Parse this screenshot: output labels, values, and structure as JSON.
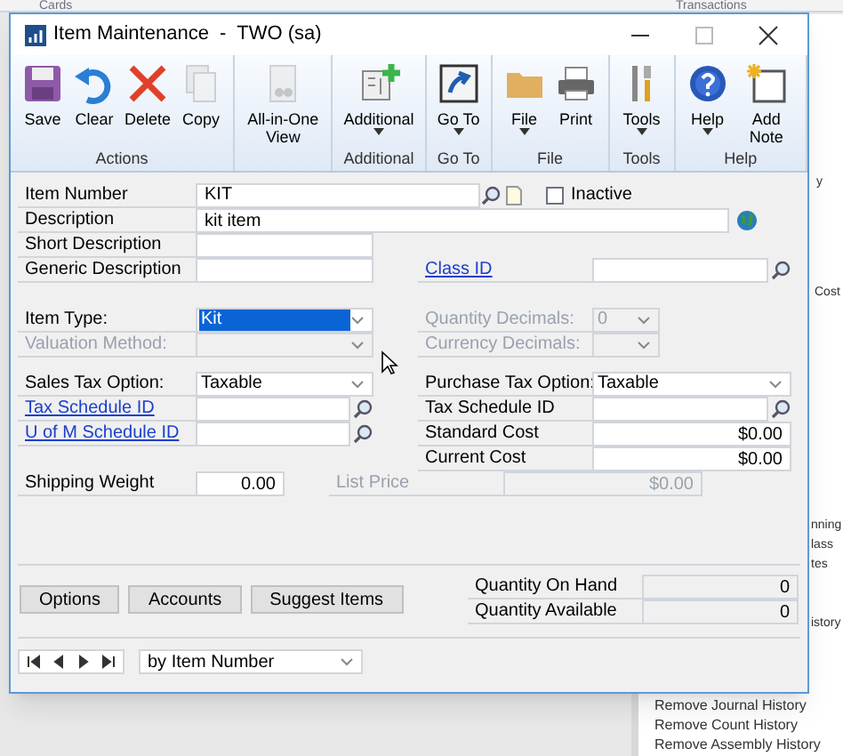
{
  "background": {
    "tabs": [
      "Cards",
      "Transactions"
    ],
    "fragments": [
      "y",
      "Cost",
      "nning",
      "lass",
      "tes",
      "istory"
    ],
    "list": [
      "Remove Journal History",
      "Remove Count History",
      "Remove Assembly History"
    ]
  },
  "window": {
    "title": "Item Maintenance  -  TWO (sa)"
  },
  "ribbon": [
    {
      "group": "Actions",
      "buttons": [
        {
          "label": "Save",
          "dropdown": false,
          "disabled": false
        },
        {
          "label": "Clear",
          "dropdown": false,
          "disabled": false
        },
        {
          "label": "Delete",
          "dropdown": false,
          "disabled": false
        },
        {
          "label": "Copy",
          "dropdown": false,
          "disabled": true
        }
      ]
    },
    {
      "buttons": [
        {
          "label": "All-in-One View",
          "dropdown": false,
          "disabled": true
        }
      ]
    },
    {
      "group": "Additional",
      "buttons": [
        {
          "label": "Additional",
          "dropdown": true,
          "disabled": false
        }
      ]
    },
    {
      "group": "Go To",
      "buttons": [
        {
          "label": "Go To",
          "dropdown": true,
          "disabled": false
        }
      ]
    },
    {
      "group": "File",
      "buttons": [
        {
          "label": "File",
          "dropdown": true,
          "disabled": false
        },
        {
          "label": "Print",
          "dropdown": false,
          "disabled": false
        }
      ]
    },
    {
      "group": "Tools",
      "buttons": [
        {
          "label": "Tools",
          "dropdown": true,
          "disabled": false
        }
      ]
    },
    {
      "group": "Help",
      "buttons": [
        {
          "label": "Help",
          "dropdown": true,
          "disabled": false
        },
        {
          "label": "Add Note",
          "dropdown": false,
          "disabled": false
        }
      ]
    }
  ],
  "item_number": {
    "label": "Item Number",
    "value": "KIT"
  },
  "inactive": {
    "label": "Inactive",
    "checked": false
  },
  "description": {
    "label": "Description",
    "value": "kit item"
  },
  "groups": [
    [
      {
        "left": {
          "label": "Short Description",
          "kind": "text",
          "link": false,
          "disabled": false
        }
      }
    ],
    [
      {
        "left": {
          "label": "Generic Description",
          "kind": "text",
          "link": false,
          "disabled": false
        },
        "right": {
          "label": "Class ID",
          "kind": "lookup",
          "link": true,
          "disabled": false
        }
      }
    ],
    [
      {
        "left": {
          "label": "Item Type:",
          "kind": "dropdown",
          "link": false,
          "disabled": false,
          "value": "Kit",
          "selected": true
        },
        "right": {
          "label": "Quantity Decimals:",
          "kind": "small_dropdown",
          "link": false,
          "disabled": true,
          "value": "0"
        }
      },
      {
        "left": {
          "label": "Valuation Method:",
          "kind": "dropdown",
          "link": false,
          "disabled": true
        },
        "right": {
          "label": "Currency Decimals:",
          "kind": "small_dropdown",
          "link": false,
          "disabled": true
        }
      }
    ],
    [
      {
        "left": {
          "label": "Sales Tax Option:",
          "kind": "dropdown",
          "link": false,
          "disabled": false,
          "value": "Taxable",
          "selected": false
        },
        "right": {
          "label": "Purchase Tax Option:",
          "kind": "dropdown",
          "link": false,
          "disabled": false,
          "value": "Taxable",
          "selected": false
        }
      },
      {
        "left": {
          "label": "Tax Schedule ID",
          "kind": "lookup",
          "link": true,
          "disabled": false
        },
        "right": {
          "label": "Tax Schedule ID",
          "kind": "lookup",
          "link": false,
          "disabled": false
        }
      },
      {
        "left": {
          "label": "U of M Schedule ID",
          "kind": "lookup",
          "link": true,
          "disabled": false
        },
        "right": {
          "label": "Standard Cost",
          "kind": "amount",
          "link": false,
          "disabled": false,
          "value": "$0.00"
        }
      },
      {
        "right": {
          "label": "Current Cost",
          "kind": "amount",
          "link": false,
          "disabled": false,
          "value": "$0.00"
        }
      },
      {
        "left": {
          "label": "Shipping Weight",
          "kind": "short_amount",
          "link": false,
          "disabled": false,
          "value": "0.00"
        },
        "right": {
          "label": "List Price",
          "kind": "amount",
          "link": false,
          "disabled": true,
          "value": "$0.00"
        }
      }
    ]
  ],
  "buttons": [
    "Options",
    "Accounts",
    "Suggest Items"
  ],
  "quantities": [
    {
      "label": "Quantity On Hand",
      "value": "0"
    },
    {
      "label": "Quantity Available",
      "value": "0"
    }
  ],
  "browse": {
    "sort": "by Item Number"
  }
}
